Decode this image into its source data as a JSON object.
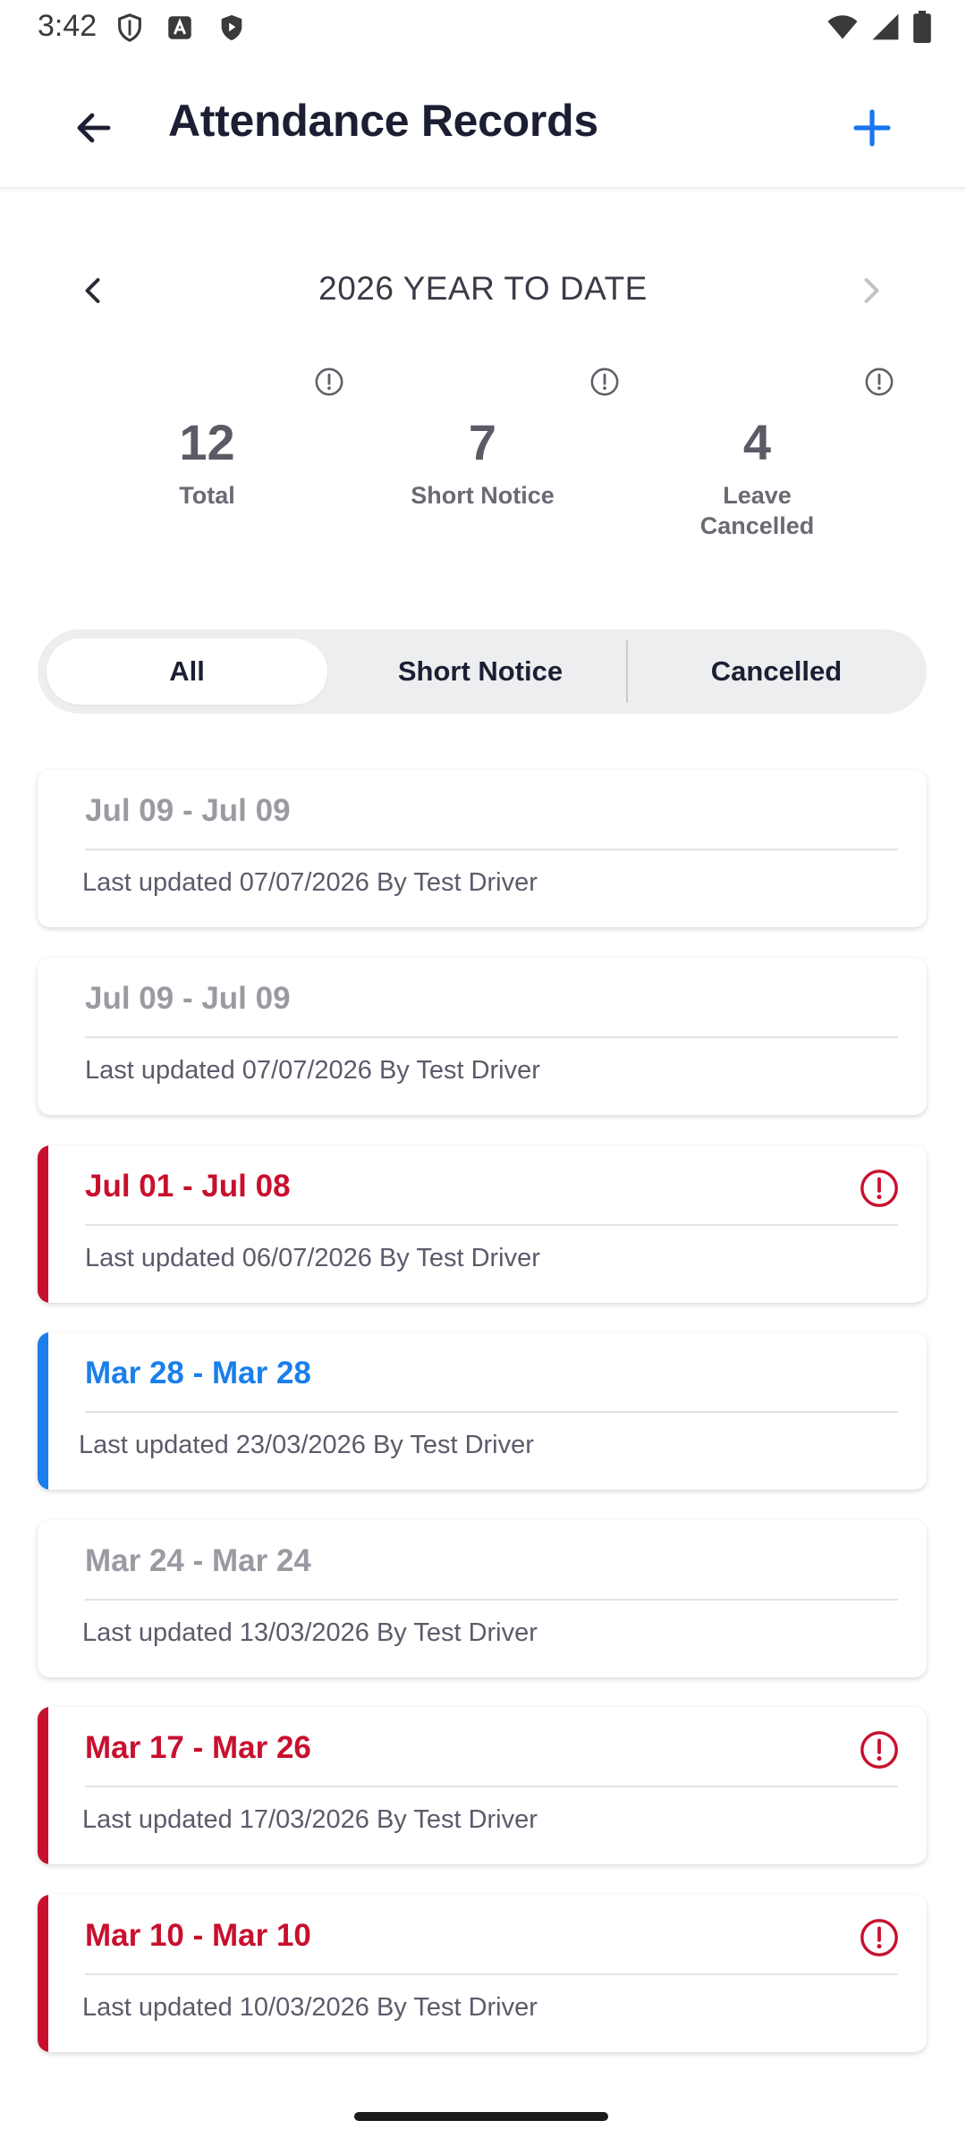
{
  "status_bar": {
    "time": "3:42",
    "left_icons": [
      "shield-outline-icon",
      "text-a-icon",
      "shield-play-icon"
    ],
    "right_icons": [
      "wifi-icon",
      "signal-icon",
      "battery-icon"
    ]
  },
  "app_bar": {
    "title": "Attendance Records",
    "back_icon": "arrow-left-icon",
    "add_icon": "plus-icon",
    "accent_color": "#1976f0"
  },
  "period": {
    "label": "2026 YEAR TO DATE",
    "prev_icon": "chevron-left-icon",
    "next_icon": "chevron-right-icon"
  },
  "stats": [
    {
      "value": "12",
      "label": "Total",
      "icon": "info-icon"
    },
    {
      "value": "7",
      "label": "Short Notice",
      "icon": "info-icon"
    },
    {
      "value": "4",
      "label": "Leave Cancelled",
      "icon": "info-icon"
    }
  ],
  "filter_tabs": {
    "selected": "All",
    "items": [
      "All",
      "Short Notice",
      "Cancelled"
    ]
  },
  "colors": {
    "red": "#c8102e",
    "blue": "#1a7fea",
    "grey_text": "#9a9aa2"
  },
  "records": [
    {
      "date_range": "Jul 09 - Jul 09",
      "updated": "Last updated 07/07/2026 By Test Driver",
      "status": "cancelled",
      "alert": false
    },
    {
      "date_range": "Jul 09 - Jul 09",
      "updated": "Last updated 07/07/2026 By Test Driver",
      "status": "cancelled",
      "alert": false
    },
    {
      "date_range": "Jul 01 - Jul 08",
      "updated": "Last updated 06/07/2026 By Test Driver",
      "status": "short-notice",
      "alert": true
    },
    {
      "date_range": "Mar 28 - Mar 28",
      "updated": "Last updated 23/03/2026 By Test Driver",
      "status": "standard",
      "alert": false
    },
    {
      "date_range": "Mar 24 - Mar 24",
      "updated": "Last updated 13/03/2026 By Test Driver",
      "status": "cancelled",
      "alert": false
    },
    {
      "date_range": "Mar 17 - Mar 26",
      "updated": "Last updated 17/03/2026 By Test Driver",
      "status": "short-notice",
      "alert": true
    },
    {
      "date_range": "Mar 10 - Mar 10",
      "updated": "Last updated 10/03/2026 By Test Driver",
      "status": "short-notice",
      "alert": true
    }
  ]
}
